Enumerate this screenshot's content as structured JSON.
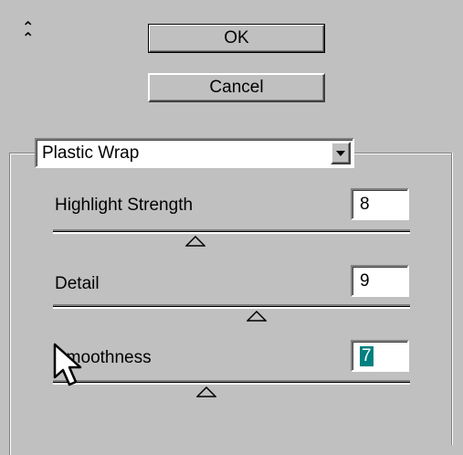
{
  "buttons": {
    "ok": "OK",
    "cancel": "Cancel"
  },
  "filter": {
    "selected": "Plastic Wrap"
  },
  "sliders": [
    {
      "label": "Highlight Strength",
      "value": "8",
      "max": 20,
      "fraction": 0.4
    },
    {
      "label": "Detail",
      "value": "9",
      "max": 15,
      "fraction": 0.57
    },
    {
      "label": "Smoothness",
      "value": "7",
      "max": 15,
      "fraction": 0.43
    }
  ],
  "icons": {
    "collapse": "collapse-chevron-icon",
    "dropdown": "dropdown-arrow-icon",
    "cursor": "mouse-pointer-icon"
  }
}
